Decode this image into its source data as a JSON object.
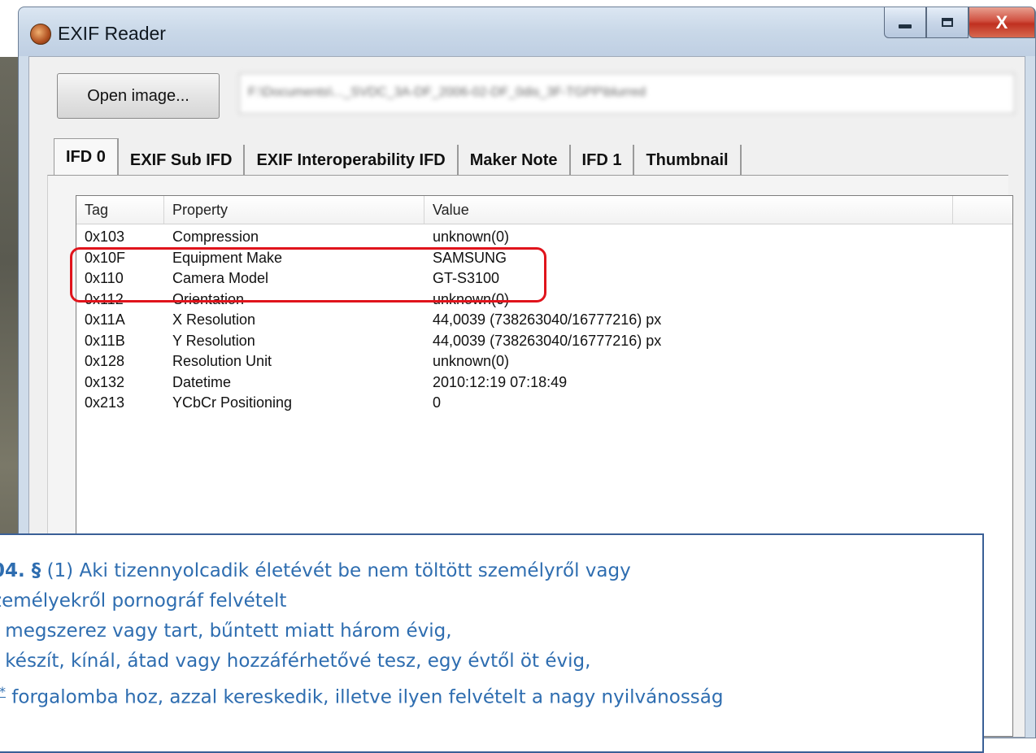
{
  "window": {
    "title": "EXIF Reader",
    "controls": {
      "minimize": "minimize",
      "maximize": "maximize",
      "close": "X"
    }
  },
  "toolbar": {
    "open_label": "Open image...",
    "path_value": "F:\\Documents\\..._SVDC_3A-DF_2006-02-DF_0dis_3F-TGPP\\blurred"
  },
  "tabs": [
    {
      "label": "IFD 0",
      "active": true
    },
    {
      "label": "EXIF Sub IFD"
    },
    {
      "label": "EXIF Interoperability IFD"
    },
    {
      "label": "Maker Note"
    },
    {
      "label": "IFD 1"
    },
    {
      "label": "Thumbnail"
    }
  ],
  "table": {
    "columns": [
      "Tag",
      "Property",
      "Value"
    ],
    "rows": [
      {
        "tag": "0x103",
        "property": "Compression",
        "value": "unknown(0)"
      },
      {
        "tag": "0x10F",
        "property": "Equipment Make",
        "value": "SAMSUNG"
      },
      {
        "tag": "0x110",
        "property": "Camera Model",
        "value": "GT-S3100"
      },
      {
        "tag": "0x112",
        "property": "Orientation",
        "value": "unknown(0)"
      },
      {
        "tag": "0x11A",
        "property": "X Resolution",
        "value": "44,0039 (738263040/16777216) px"
      },
      {
        "tag": "0x11B",
        "property": "Y Resolution",
        "value": "44,0039 (738263040/16777216) px"
      },
      {
        "tag": "0x128",
        "property": "Resolution Unit",
        "value": "unknown(0)"
      },
      {
        "tag": "0x132",
        "property": "Datetime",
        "value": "2010:12:19 07:18:49"
      },
      {
        "tag": "0x213",
        "property": "YCbCr Positioning",
        "value": "0"
      }
    ]
  },
  "legal": {
    "l1_num": "04. §",
    "l1_rest": " (1) Aki tizennyolcadik életévét be nem töltött személyről vagy",
    "l2": "zemélyekről pornográf felvételt",
    "l3_marker": ")",
    "l3_rest": " megszerez vagy tart, bűntett miatt három évig,",
    "l4_marker": ")",
    "l4_rest": " készít, kínál, átad vagy hozzáférhetővé tesz, egy évtől öt évig,",
    "l5_marker": ")",
    "l5_sup": "*",
    "l5_rest": " forgalomba hoz, azzal kereskedik, illetve ilyen felvételt a nagy nyilvánosság"
  },
  "colors": {
    "highlight": "#e0141c",
    "legal_text": "#2e6db0",
    "close_button": "#c03020"
  }
}
